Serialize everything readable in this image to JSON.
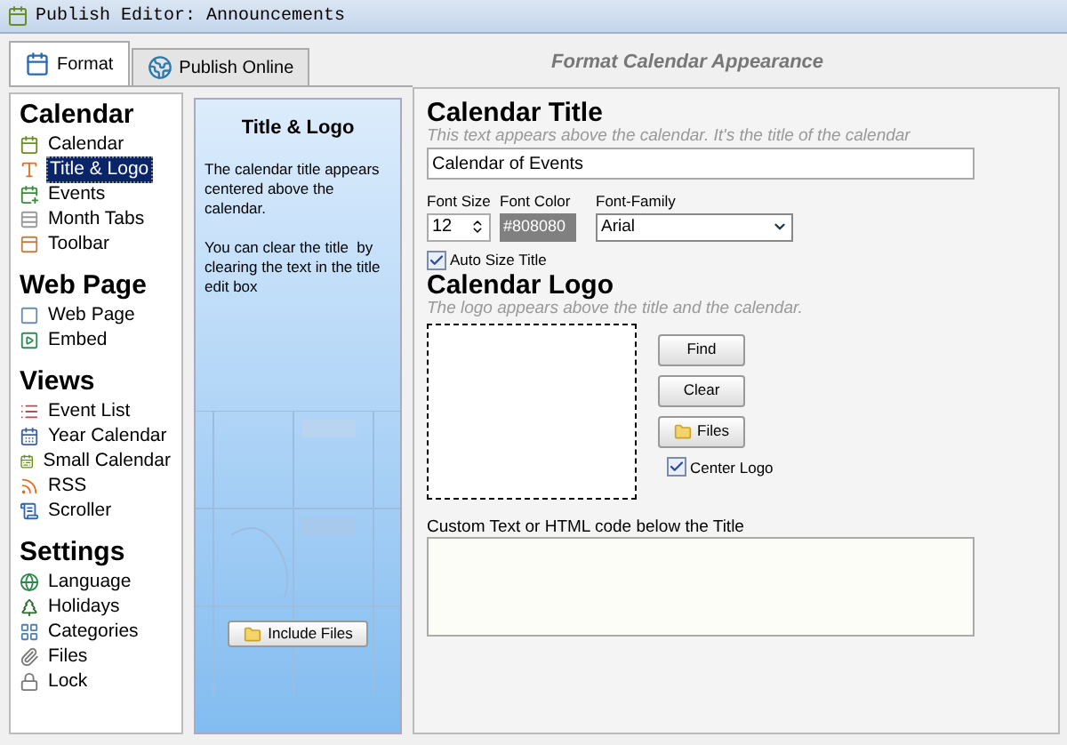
{
  "window": {
    "title": "Publish Editor: Announcements"
  },
  "tabs": [
    {
      "label": "Format",
      "selected": true
    },
    {
      "label": "Publish Online",
      "selected": false
    }
  ],
  "sidebar": {
    "sections": [
      {
        "heading": "Calendar",
        "items": [
          {
            "label": "Calendar",
            "selected": false
          },
          {
            "label": "Title & Logo",
            "selected": true
          },
          {
            "label": "Events",
            "selected": false
          },
          {
            "label": "Month Tabs",
            "selected": false
          },
          {
            "label": "Toolbar",
            "selected": false
          }
        ]
      },
      {
        "heading": "Web Page",
        "items": [
          {
            "label": "Web Page",
            "selected": false
          },
          {
            "label": "Embed",
            "selected": false
          }
        ]
      },
      {
        "heading": "Views",
        "items": [
          {
            "label": "Event List",
            "selected": false
          },
          {
            "label": "Year Calendar",
            "selected": false
          },
          {
            "label": "Small Calendar",
            "selected": false
          },
          {
            "label": "RSS",
            "selected": false
          },
          {
            "label": "Scroller",
            "selected": false
          }
        ]
      },
      {
        "heading": "Settings",
        "items": [
          {
            "label": "Language",
            "selected": false
          },
          {
            "label": "Holidays",
            "selected": false
          },
          {
            "label": "Categories",
            "selected": false
          },
          {
            "label": "Files",
            "selected": false
          },
          {
            "label": "Lock",
            "selected": false
          }
        ]
      }
    ]
  },
  "help_panel": {
    "title": "Title & Logo",
    "paragraphs": [
      "The calendar title appears centered above the calendar.",
      "You can clear the title  by clearing the text in the title edit box"
    ],
    "button": "Include Files"
  },
  "main": {
    "header": "Format Calendar Appearance",
    "title_section": {
      "heading": "Calendar Title",
      "hint": "This text appears above the calendar.  It's the title of the calendar",
      "value": "Calendar of Events",
      "font_size": {
        "label": "Font Size",
        "value": "12"
      },
      "font_color": {
        "label": "Font Color",
        "value": "#808080",
        "color": "#808080"
      },
      "font_family": {
        "label": "Font-Family",
        "value": "Arial"
      },
      "auto_size": {
        "label": "Auto Size Title",
        "checked": true
      }
    },
    "logo_section": {
      "heading": "Calendar Logo",
      "hint": "The logo appears above the title and the calendar.",
      "buttons": [
        "Find",
        "Clear",
        "Files"
      ],
      "center_logo": {
        "label": "Center Logo",
        "checked": true
      }
    },
    "custom_text": {
      "label": "Custom Text or HTML code below the Title"
    }
  }
}
